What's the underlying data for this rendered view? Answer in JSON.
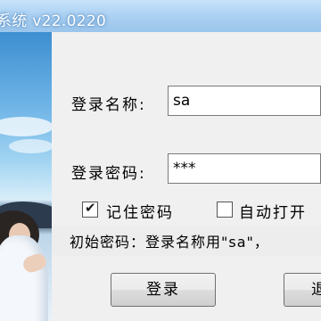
{
  "window": {
    "title": "系统 v22.0220"
  },
  "login": {
    "username_label": "登录名称:",
    "username_value": "sa",
    "password_label": "登录密码:",
    "password_value": "***",
    "remember_label": "记住密码",
    "remember_checked": true,
    "auto_open_label": "自动打开",
    "auto_open_checked": false,
    "hint": "初始密码：登录名称用\"sa\"，"
  },
  "buttons": {
    "login_label": "登录",
    "cancel_label": "退"
  }
}
